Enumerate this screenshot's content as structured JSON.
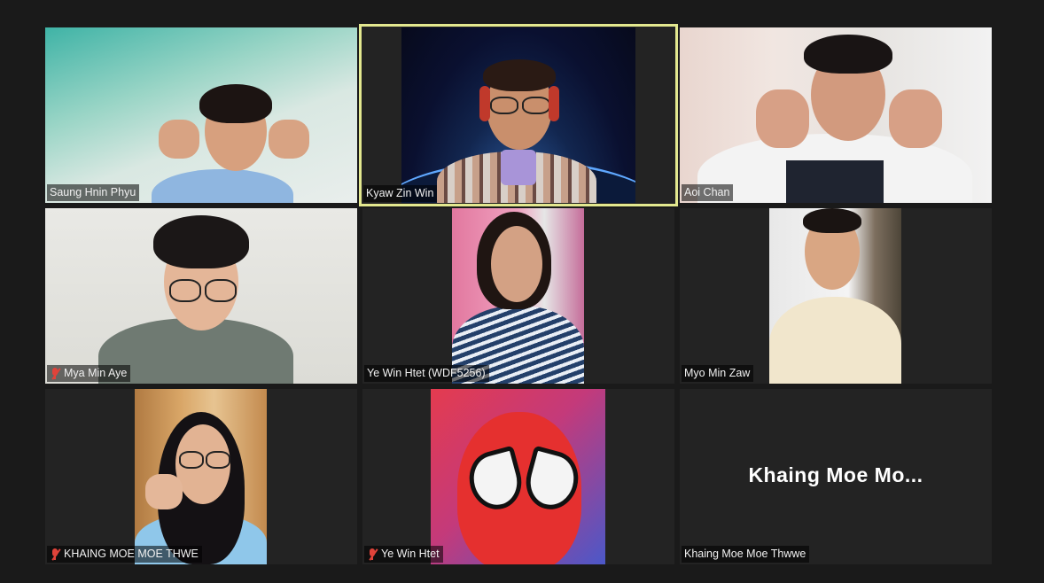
{
  "participants": [
    {
      "name": "Saung Hnin Phyu",
      "muted": false,
      "active": false
    },
    {
      "name": "Kyaw Zin Win",
      "muted": false,
      "active": true
    },
    {
      "name": "Aoi Chan",
      "muted": false,
      "active": false
    },
    {
      "name": "Mya Min Aye",
      "muted": true,
      "active": false
    },
    {
      "name": "Ye Win Htet (WDF5256)",
      "muted": false,
      "active": false
    },
    {
      "name": "Myo Min Zaw",
      "muted": false,
      "active": false
    },
    {
      "name": "KHAING MOE MOE THWE",
      "muted": true,
      "active": false
    },
    {
      "name": "Ye Win Htet",
      "muted": true,
      "active": false
    },
    {
      "name": "Khaing Moe Moe Thwwe",
      "muted": false,
      "active": false
    }
  ],
  "no_video_label": "Khaing Moe Mo...",
  "colors": {
    "background": "#1a1a1a",
    "tile": "#232323",
    "active_speaker_border": "#e3e88f",
    "muted_icon": "#e0433a"
  },
  "icons": [
    "microphone-muted-icon"
  ]
}
